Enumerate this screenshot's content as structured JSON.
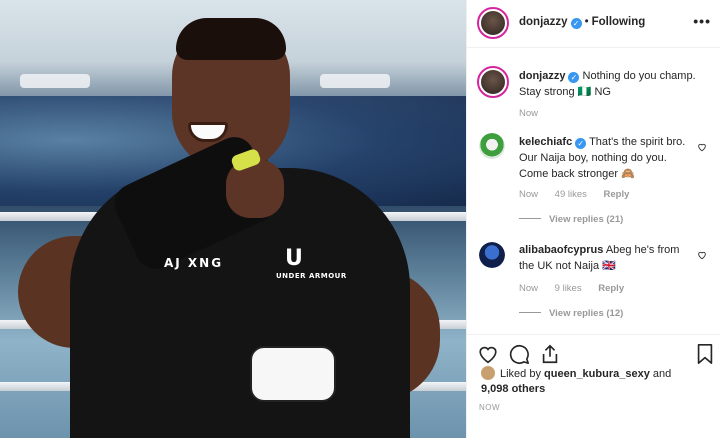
{
  "post": {
    "author": "donjazzy",
    "follow_status": "Following",
    "more_label": "•••",
    "photo_texts": {
      "shirt_name": "AJ XNG",
      "brand_mark": "U",
      "brand": "UNDER ARMOUR"
    }
  },
  "caption": {
    "author": "donjazzy",
    "text": "Nothing do you champ. Stay strong 🇳🇬 NG",
    "time": "Now"
  },
  "comments": [
    {
      "author": "kelechiafc",
      "verified": true,
      "text": "That's the spirit bro. Our Naija boy, nothing do you. Come back stronger 🙈",
      "time": "Now",
      "likes": "49 likes",
      "reply_label": "Reply",
      "view_replies": "View replies (21)"
    },
    {
      "author": "alibabaofcyprus",
      "verified": false,
      "text": "Abeg he's from the UK not Naija 🇬🇧",
      "time": "Now",
      "likes": "9 likes",
      "reply_label": "Reply",
      "view_replies": "View replies (12)"
    }
  ],
  "likes": {
    "prefix": "Liked by",
    "user": "queen_kubura_sexy",
    "joiner": "and",
    "others": "9,098 others"
  },
  "timestamp": "NOW",
  "icons": [
    "heart-icon",
    "comment-icon",
    "share-icon",
    "bookmark-icon",
    "verified-icon",
    "more-icon"
  ],
  "colors": {
    "verified": "#3897f0",
    "story_ring": "#d6249f",
    "muted": "#999999"
  }
}
